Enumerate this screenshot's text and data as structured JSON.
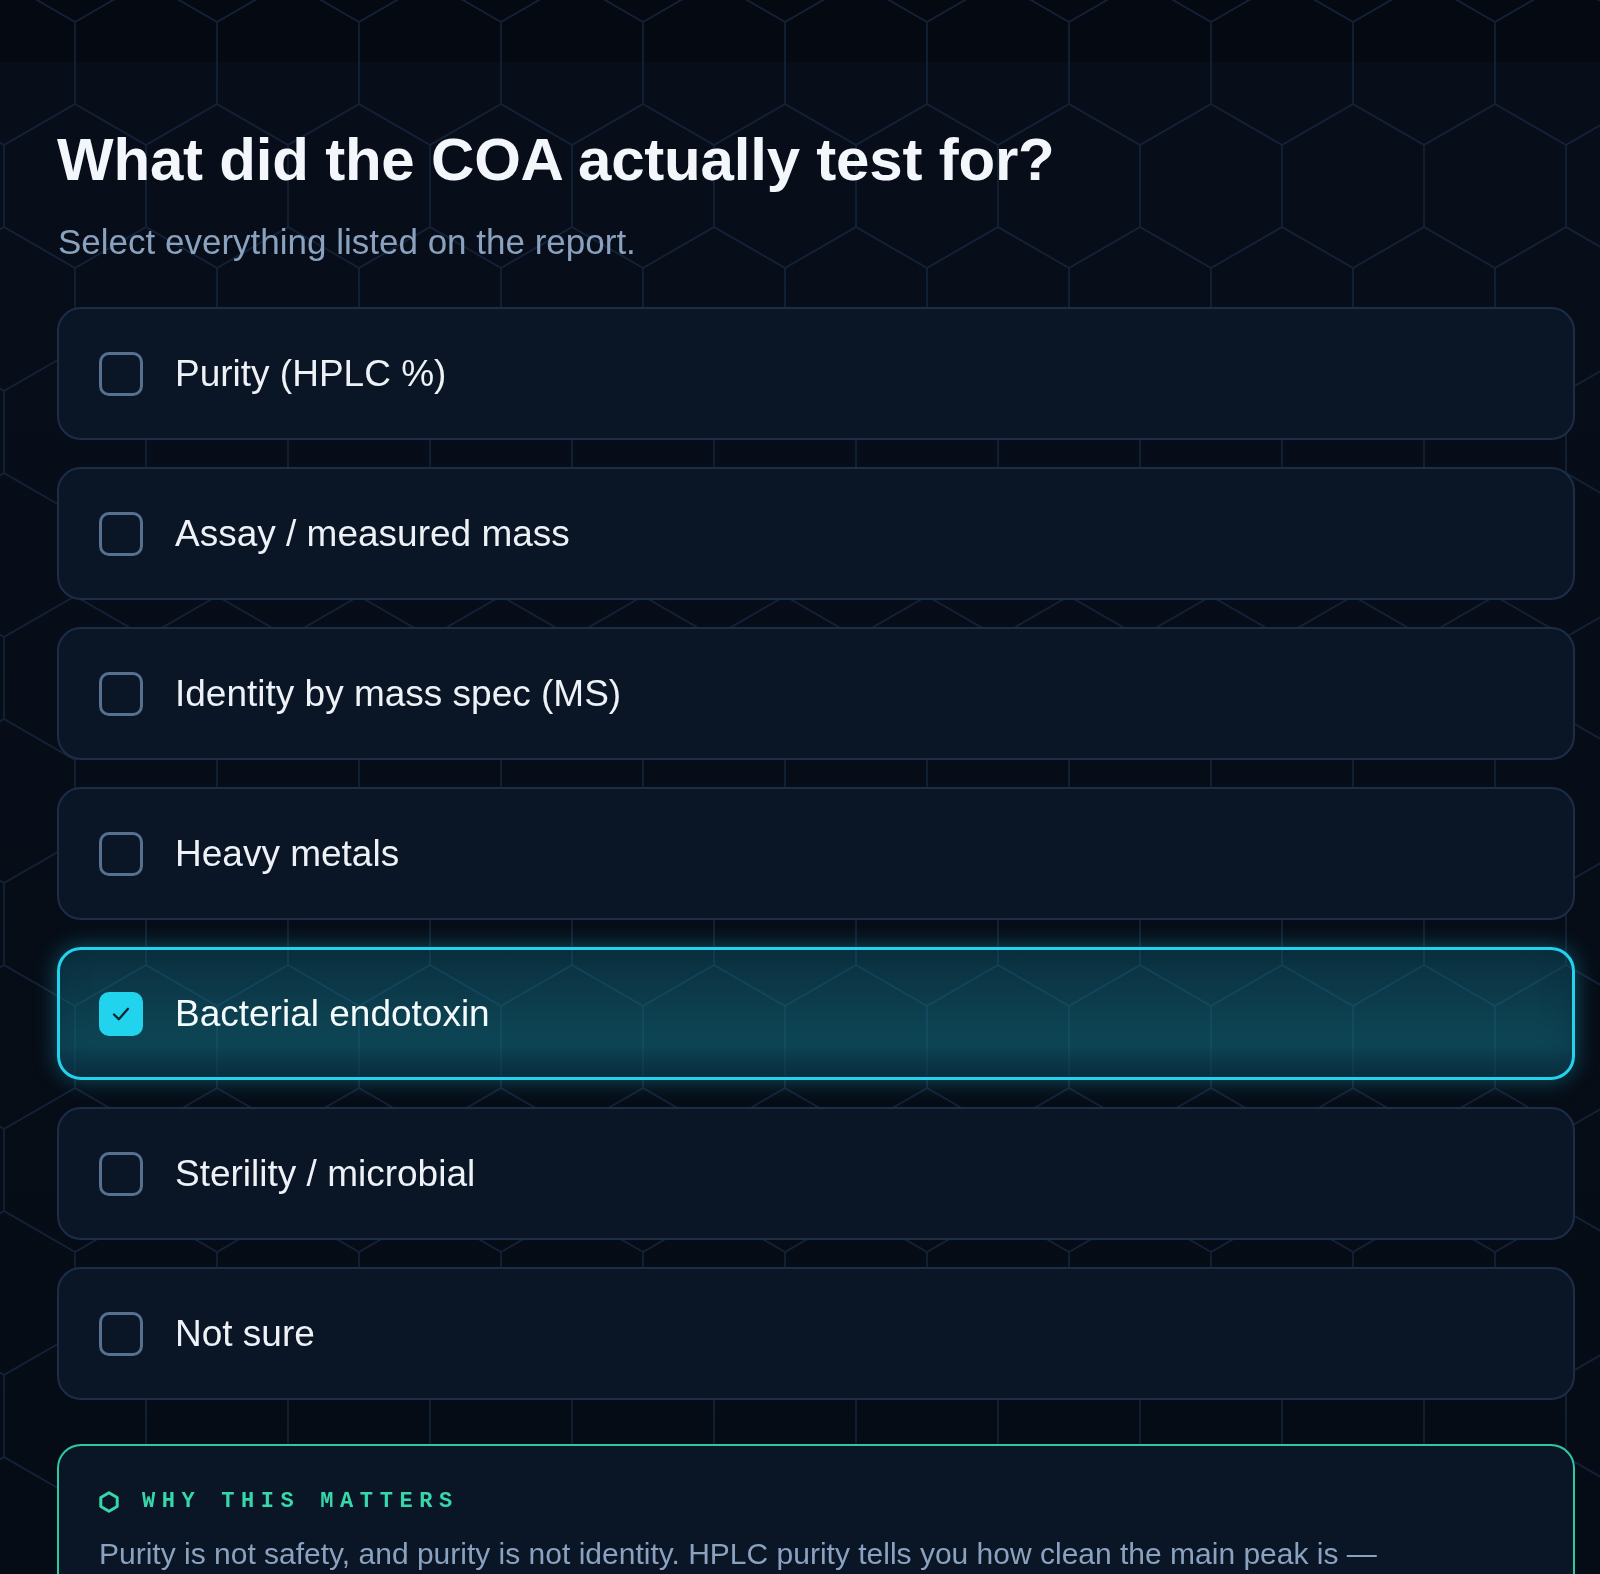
{
  "question": {
    "title": "What did the COA actually test for?",
    "subtitle": "Select everything listed on the report."
  },
  "options": [
    {
      "label": "Purity (HPLC %)",
      "checked": false
    },
    {
      "label": "Assay / measured mass",
      "checked": false
    },
    {
      "label": "Identity by mass spec (MS)",
      "checked": false
    },
    {
      "label": "Heavy metals",
      "checked": false
    },
    {
      "label": "Bacterial endotoxin",
      "checked": true
    },
    {
      "label": "Sterility / microbial",
      "checked": false
    },
    {
      "label": "Not sure",
      "checked": false
    }
  ],
  "note": {
    "heading": "WHY THIS MATTERS",
    "text": "Purity is not safety, and purity is not identity. HPLC purity tells you how clean the main peak is —"
  }
}
